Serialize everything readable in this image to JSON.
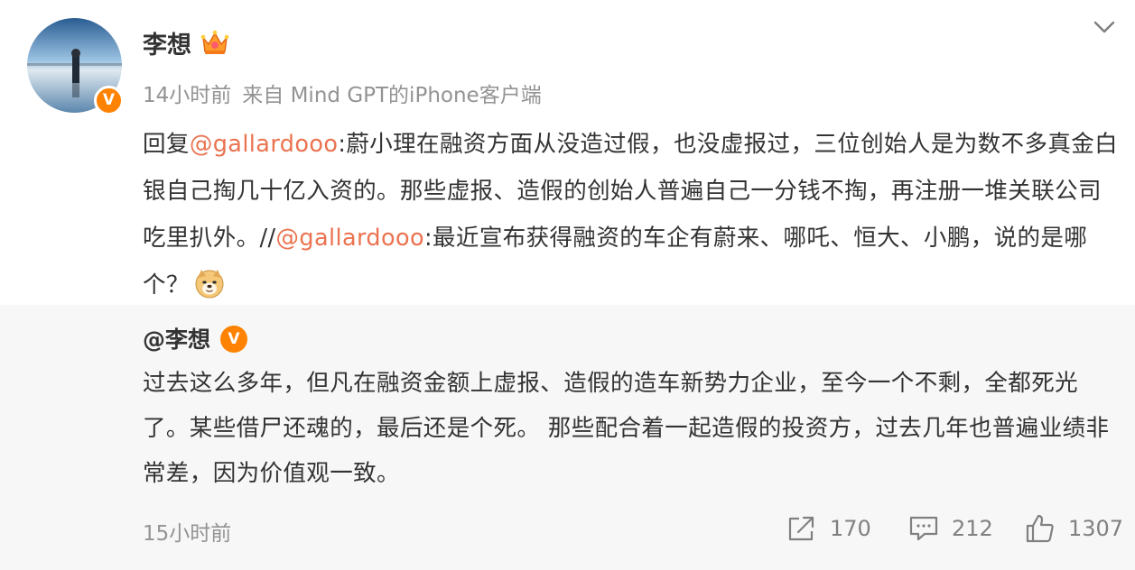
{
  "post": {
    "author": "李想",
    "time": "14小时前",
    "source": "来自 Mind GPT的iPhone客户端",
    "text": {
      "prefix": "回复",
      "mention1": "@gallardooo",
      "body1": ":蔚小理在融资方面从没造过假，也没虚报过，三位创始人是为数不多真金白银自己掏几十亿入资的。那些虚报、造假的创始人普遍自己一分钱不掏，再注册一堆关联公司吃里扒外。//",
      "mention2": "@gallardooo",
      "body2": ":最近宣布获得融资的车企有蔚来、哪吒、恒大、小鹏，说的是哪个？"
    },
    "icons": {
      "avatar": "profile-photo",
      "verified": "verified-v-badge",
      "crown": "crown-badge-icon",
      "more": "chevron-down-icon",
      "emoji": "doge-emoji"
    },
    "verified_label": "V"
  },
  "repost": {
    "author": "@李想",
    "verified_label": "V",
    "text": "过去这么多年，但凡在融资金额上虚报、造假的造车新势力企业，至今一个不剩，全都死光了。某些借尸还魂的，最后还是个死。 那些配合着一起造假的投资方，过去几年也普遍业绩非常差，因为价值观一致。",
    "time": "15小时前",
    "actions": {
      "reposts": "170",
      "comments": "212",
      "likes": "1307"
    }
  },
  "colors": {
    "mention": "#eb7350",
    "verified": "#ff8200",
    "meta": "#939393",
    "repost_bg": "#f7f7f7"
  }
}
